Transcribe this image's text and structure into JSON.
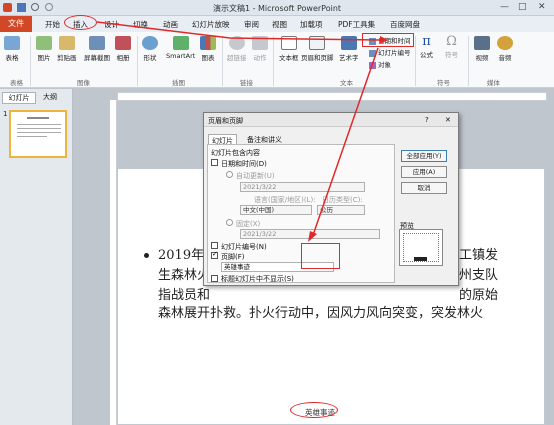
{
  "window": {
    "title": "演示文稿1 - Microsoft PowerPoint",
    "minimize": "—",
    "maximize": "□",
    "close": "✕"
  },
  "tabs": [
    "文件",
    "开始",
    "插入",
    "设计",
    "切换",
    "动画",
    "幻灯片放映",
    "审阅",
    "视图",
    "加载项",
    "PDF工具集",
    "百度网盘"
  ],
  "ribbon": {
    "groups": [
      "表格",
      "图像",
      "插图",
      "链接",
      "文本",
      "符号",
      "媒体"
    ],
    "buttons": [
      "表格",
      "图片",
      "剪贴画",
      "屏幕截图",
      "相册",
      "形状",
      "SmartArt",
      "图表",
      "超链接",
      "动作",
      "文本框",
      "页眉和页脚",
      "艺术字",
      "公式",
      "符号",
      "视频",
      "音频"
    ],
    "small_buttons": [
      "日期和时间",
      "幻灯片编号",
      "对象"
    ]
  },
  "panel": {
    "tab_slides": "幻灯片",
    "tab_outline": "大纲",
    "slide_number": "1"
  },
  "slide": {
    "lines": [
      "2019年3",
      "生森林火",
      "指战员和",
      "森林展开扑救。扑火行动中，因风力风向突变，突发林火"
    ],
    "right_fragments": [
      "工镇发",
      "州支队",
      "的原始"
    ],
    "footer": "英雄事迹"
  },
  "dialog": {
    "title": "页眉和页脚",
    "help": "?",
    "close": "✕",
    "tab_slide": "幻灯片",
    "tab_notes": "备注和讲义",
    "section": "幻灯片包含内容",
    "date_time": "日期和时间(D)",
    "auto_update": "自动更新(U)",
    "date_value": "2021/3/22",
    "language_label": "语言(国家/地区)(L):",
    "calendar_label": "日历类型(C):",
    "language_value": "中文(中国)",
    "calendar_value": "公历",
    "fixed": "固定(X)",
    "fixed_value": "2021/3/22",
    "slide_number": "幻灯片编号(N)",
    "footer": "页脚(F)",
    "footer_value": "英雄事迹",
    "no_title": "标题幻灯片中不显示(S)",
    "preview": "预览",
    "apply_all": "全部应用(Y)",
    "apply": "应用(A)",
    "cancel": "取消"
  }
}
